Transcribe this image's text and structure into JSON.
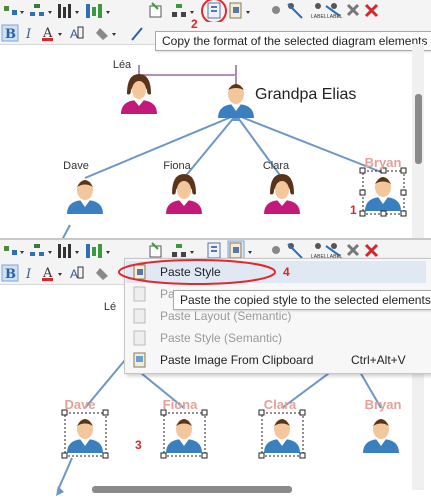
{
  "top": {
    "tooltip": "Copy the format of the selected diagram elements",
    "people": [
      {
        "id": "lea",
        "name": "Léa",
        "gender": "female",
        "selected": false
      },
      {
        "id": "elias",
        "name": "Grandpa Elias",
        "gender": "male",
        "selected": false
      },
      {
        "id": "dave",
        "name": "Dave",
        "gender": "male",
        "selected": false
      },
      {
        "id": "fiona",
        "name": "Fiona",
        "gender": "female",
        "selected": false
      },
      {
        "id": "clara",
        "name": "Clara",
        "gender": "female",
        "selected": false
      },
      {
        "id": "bryan",
        "name": "Bryan",
        "gender": "male",
        "selected": true
      }
    ],
    "steps": {
      "copy_format": "2",
      "select_source": "1"
    }
  },
  "bottom": {
    "menu": {
      "items": [
        {
          "label": "Paste Style",
          "shortcut": "",
          "enabled": true,
          "highlighted": true
        },
        {
          "label": "Pa",
          "shortcut": "",
          "enabled": false,
          "highlighted": false
        },
        {
          "label": "Paste Layout (Semantic)",
          "shortcut": "",
          "enabled": false,
          "highlighted": false
        },
        {
          "label": "Paste Style (Semantic)",
          "shortcut": "",
          "enabled": false,
          "highlighted": false
        },
        {
          "label": "Paste Image From Clipboard",
          "shortcut": "Ctrl+Alt+V",
          "enabled": true,
          "highlighted": false
        }
      ]
    },
    "tooltip": "Paste the copied style to the selected elements",
    "people": [
      {
        "id": "dave",
        "name": "Dave",
        "selected": true
      },
      {
        "id": "fiona",
        "name": "Fiona",
        "selected": true
      },
      {
        "id": "clara",
        "name": "Clara",
        "selected": true
      },
      {
        "id": "bryan",
        "name": "Bryan",
        "selected": false
      }
    ],
    "partial_label": "Lé",
    "steps": {
      "paste_style": "4",
      "select_targets": "3"
    }
  },
  "toolbar": {
    "label_text": "LABEL",
    "icons": [
      "connector-icon",
      "tree-layout-icon",
      "bar-icon",
      "node-icon",
      "add-shape-icon",
      "hierarchy-icon",
      "copy-format-icon",
      "paste-format-icon",
      "dot-icon",
      "link-icon",
      "label-icon",
      "label-link-icon",
      "delete-icon",
      "delete-all-icon"
    ],
    "format_icons": [
      "bold-icon",
      "italic-icon",
      "font-color-icon",
      "text-style-icon",
      "fill-icon",
      "line-color-icon"
    ]
  },
  "colors": {
    "highlight_circle": "#e0282e",
    "step_number": "#d9262b",
    "selected_name": "#e6a09a",
    "connector": "#6b97c7",
    "spouse_line": "#9b6aa5",
    "male_shirt": "#3a7fc0",
    "female_shirt": "#c2197a",
    "skin": "#f2c79c",
    "hair_dark": "#5a3419"
  }
}
